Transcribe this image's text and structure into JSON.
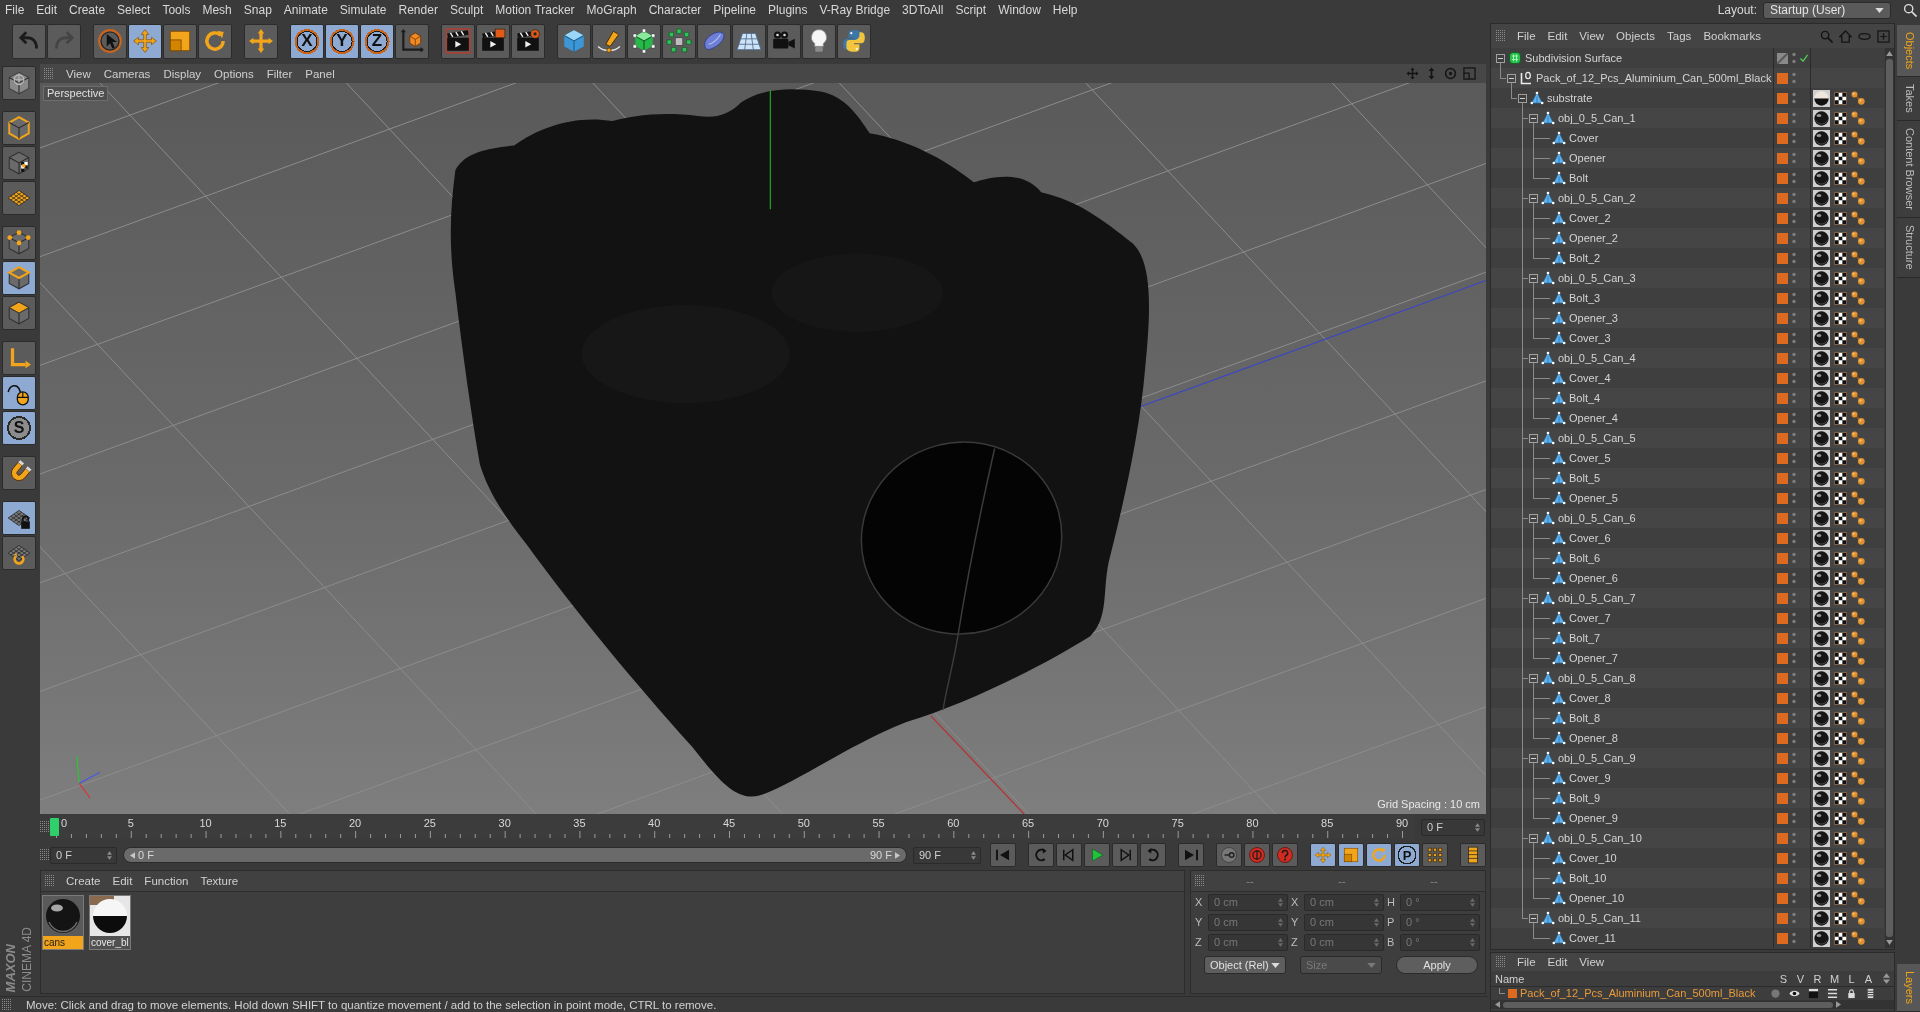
{
  "menubar": {
    "items": [
      "File",
      "Edit",
      "Create",
      "Select",
      "Tools",
      "Mesh",
      "Snap",
      "Animate",
      "Simulate",
      "Render",
      "Sculpt",
      "Motion Tracker",
      "MoGraph",
      "Character",
      "Pipeline",
      "Plugins",
      "V-Ray Bridge",
      "3DToAll",
      "Script",
      "Window",
      "Help"
    ],
    "layout_label": "Layout:",
    "layout_value": "Startup (User)"
  },
  "toolbar": {
    "groups": [
      [
        {
          "kind": "undo",
          "disabled": false
        },
        {
          "kind": "redo",
          "disabled": true
        }
      ],
      [
        {
          "kind": "liveselect",
          "selected": false
        },
        {
          "kind": "move",
          "selected": true
        },
        {
          "kind": "scale",
          "selected": false
        },
        {
          "kind": "rotate",
          "selected": false
        }
      ],
      [
        {
          "kind": "lasttool"
        }
      ],
      [
        {
          "kind": "axis",
          "label": "X",
          "selected": true
        },
        {
          "kind": "axis",
          "label": "Y",
          "selected": true
        },
        {
          "kind": "axis",
          "label": "Z",
          "selected": true
        },
        {
          "kind": "coordsystem"
        }
      ],
      [
        {
          "kind": "renderview"
        },
        {
          "kind": "renderpv"
        },
        {
          "kind": "rendersettings"
        }
      ],
      [
        {
          "kind": "cube"
        },
        {
          "kind": "pen"
        },
        {
          "kind": "subdivision"
        },
        {
          "kind": "cloner"
        },
        {
          "kind": "bend"
        },
        {
          "kind": "floor"
        },
        {
          "kind": "camera"
        },
        {
          "kind": "light"
        },
        {
          "kind": "python"
        }
      ]
    ]
  },
  "tool_palette": {
    "groups": [
      [
        {
          "kind": "makeeditable"
        }
      ],
      [
        {
          "kind": "model",
          "selected": false
        },
        {
          "kind": "texture",
          "selected": false
        },
        {
          "kind": "workplane",
          "selected": false
        }
      ],
      [
        {
          "kind": "points",
          "selected": false
        },
        {
          "kind": "edges",
          "selected": true
        },
        {
          "kind": "polygons",
          "selected": false
        }
      ],
      [
        {
          "kind": "axismode",
          "selected": false
        },
        {
          "kind": "tweak",
          "selected": true
        },
        {
          "kind": "solo",
          "label": "S",
          "selected": true
        }
      ],
      [
        {
          "kind": "magnet",
          "selected": false
        }
      ],
      [
        {
          "kind": "lockworkplane",
          "selected": true
        },
        {
          "kind": "planar",
          "selected": false
        }
      ]
    ],
    "brand": "MAXON",
    "product": "CINEMA 4D"
  },
  "viewport": {
    "menu": [
      "View",
      "Cameras",
      "Display",
      "Options",
      "Filter",
      "Panel"
    ],
    "camera": "Perspective",
    "grid_spacing": "Grid Spacing : 10 cm"
  },
  "timeline": {
    "ruler_labels": [
      "0",
      "5",
      "10",
      "15",
      "20",
      "25",
      "30",
      "35",
      "40",
      "45",
      "50",
      "55",
      "60",
      "65",
      "70",
      "75",
      "80",
      "85",
      "90"
    ],
    "level": 0,
    "current_frame": "0 F",
    "start_field": "0 F",
    "range": {
      "start": "0 F",
      "end": "90 F"
    },
    "end_field": "90 F",
    "controls": [
      [
        {
          "kind": "start"
        }
      ],
      [
        {
          "kind": "prevkey"
        },
        {
          "kind": "prevframe"
        },
        {
          "kind": "play"
        },
        {
          "kind": "nextframe"
        },
        {
          "kind": "nextkey"
        }
      ],
      [
        {
          "kind": "end"
        }
      ],
      [
        {
          "kind": "recordkeys"
        },
        {
          "kind": "autokey"
        },
        {
          "kind": "keyselection"
        }
      ],
      [
        {
          "kind": "poskey",
          "selected": true
        },
        {
          "kind": "scalekey",
          "selected": true
        },
        {
          "kind": "rotkey",
          "selected": true
        },
        {
          "kind": "paramkey",
          "label": "P",
          "selected": true
        },
        {
          "kind": "pla",
          "selected": false
        }
      ],
      [
        {
          "kind": "timelinewindow"
        }
      ]
    ]
  },
  "materials": {
    "menu": [
      "Create",
      "Edit",
      "Function",
      "Texture"
    ],
    "items": [
      {
        "name": "cans",
        "kind": "dark",
        "selected": true
      },
      {
        "name": "cover_bl",
        "kind": "split",
        "selected": false
      }
    ]
  },
  "coordinates": {
    "headers": [
      "--",
      "--",
      "--"
    ],
    "disabled": true,
    "rows": [
      {
        "position_axis": "X",
        "position": "0 cm",
        "size_axis": "X",
        "size": "0 cm",
        "rotation_axis": "H",
        "rotation": "0 °"
      },
      {
        "position_axis": "Y",
        "position": "0 cm",
        "size_axis": "Y",
        "size": "0 cm",
        "rotation_axis": "P",
        "rotation": "0 °"
      },
      {
        "position_axis": "Z",
        "position": "0 cm",
        "size_axis": "Z",
        "size": "0 cm",
        "rotation_axis": "B",
        "rotation": "0 °"
      }
    ],
    "mode": "Object (Rel)",
    "size_mode": "Size",
    "size_mode_disabled": true,
    "apply": "Apply"
  },
  "status_bar": {
    "text": "Move: Click and drag to move elements. Hold down SHIFT to quantize movement / add to the selection in point mode, CTRL to remove."
  },
  "objects": {
    "menu": [
      "File",
      "Edit",
      "View",
      "Objects",
      "Tags",
      "Bookmarks"
    ],
    "tree": [
      {
        "name": "Subdivision Surface",
        "kind": "subdivision",
        "expanded": true,
        "enabled": true,
        "children": [
          {
            "name": "Pack_of_12_Pcs_Aluminium_Can_500ml_Black",
            "kind": "null",
            "expanded": true,
            "color": "#dd6a1e",
            "children": [
              {
                "name": "substrate",
                "kind": "polygon",
                "expanded": true,
                "color": "#dd6a1e",
                "tags": [
                  {
                    "kind": "materialsplit"
                  },
                  {
                    "kind": "uvw"
                  },
                  {
                    "kind": "selection"
                  }
                ],
                "children": [
                  {
                    "name": "obj_0_5_Can_1",
                    "kind": "polygon",
                    "expanded": true,
                    "color": "#dd6a1e",
                    "tags": [
                      {
                        "kind": "material"
                      },
                      {
                        "kind": "uvw"
                      },
                      {
                        "kind": "selection"
                      }
                    ],
                    "children": [
                      {
                        "name": "Cover",
                        "kind": "polygon",
                        "color": "#dd6a1e",
                        "tags": [
                          {
                            "kind": "material"
                          },
                          {
                            "kind": "uvw"
                          },
                          {
                            "kind": "selection"
                          }
                        ]
                      },
                      {
                        "name": "Opener",
                        "kind": "polygon",
                        "color": "#dd6a1e",
                        "tags": [
                          {
                            "kind": "material"
                          },
                          {
                            "kind": "uvw"
                          },
                          {
                            "kind": "selection"
                          }
                        ]
                      },
                      {
                        "name": "Bolt",
                        "kind": "polygon",
                        "color": "#dd6a1e",
                        "tags": [
                          {
                            "kind": "material"
                          },
                          {
                            "kind": "uvw"
                          },
                          {
                            "kind": "selection"
                          }
                        ]
                      }
                    ]
                  },
                  {
                    "name": "obj_0_5_Can_2",
                    "kind": "polygon",
                    "expanded": true,
                    "color": "#dd6a1e",
                    "tags": [
                      {
                        "kind": "material"
                      },
                      {
                        "kind": "uvw"
                      },
                      {
                        "kind": "selection"
                      }
                    ],
                    "children": [
                      {
                        "name": "Cover_2",
                        "kind": "polygon",
                        "color": "#dd6a1e",
                        "tags": [
                          {
                            "kind": "material"
                          },
                          {
                            "kind": "uvw"
                          },
                          {
                            "kind": "selection"
                          }
                        ]
                      },
                      {
                        "name": "Opener_2",
                        "kind": "polygon",
                        "color": "#dd6a1e",
                        "tags": [
                          {
                            "kind": "material"
                          },
                          {
                            "kind": "uvw"
                          },
                          {
                            "kind": "selection"
                          }
                        ]
                      },
                      {
                        "name": "Bolt_2",
                        "kind": "polygon",
                        "color": "#dd6a1e",
                        "tags": [
                          {
                            "kind": "material"
                          },
                          {
                            "kind": "uvw"
                          },
                          {
                            "kind": "selection"
                          }
                        ]
                      }
                    ]
                  },
                  {
                    "name": "obj_0_5_Can_3",
                    "kind": "polygon",
                    "expanded": true,
                    "color": "#dd6a1e",
                    "tags": [
                      {
                        "kind": "material"
                      },
                      {
                        "kind": "uvw"
                      },
                      {
                        "kind": "selection"
                      }
                    ],
                    "children": [
                      {
                        "name": "Bolt_3",
                        "kind": "polygon",
                        "color": "#dd6a1e",
                        "tags": [
                          {
                            "kind": "material"
                          },
                          {
                            "kind": "uvw"
                          },
                          {
                            "kind": "selection"
                          }
                        ]
                      },
                      {
                        "name": "Opener_3",
                        "kind": "polygon",
                        "color": "#dd6a1e",
                        "tags": [
                          {
                            "kind": "material"
                          },
                          {
                            "kind": "uvw"
                          },
                          {
                            "kind": "selection"
                          }
                        ]
                      },
                      {
                        "name": "Cover_3",
                        "kind": "polygon",
                        "color": "#dd6a1e",
                        "tags": [
                          {
                            "kind": "material"
                          },
                          {
                            "kind": "uvw"
                          },
                          {
                            "kind": "selection"
                          }
                        ]
                      }
                    ]
                  },
                  {
                    "name": "obj_0_5_Can_4",
                    "kind": "polygon",
                    "expanded": true,
                    "color": "#dd6a1e",
                    "tags": [
                      {
                        "kind": "material"
                      },
                      {
                        "kind": "uvw"
                      },
                      {
                        "kind": "selection"
                      }
                    ],
                    "children": [
                      {
                        "name": "Cover_4",
                        "kind": "polygon",
                        "color": "#dd6a1e",
                        "tags": [
                          {
                            "kind": "material"
                          },
                          {
                            "kind": "uvw"
                          },
                          {
                            "kind": "selection"
                          }
                        ]
                      },
                      {
                        "name": "Bolt_4",
                        "kind": "polygon",
                        "color": "#dd6a1e",
                        "tags": [
                          {
                            "kind": "material"
                          },
                          {
                            "kind": "uvw"
                          },
                          {
                            "kind": "selection"
                          }
                        ]
                      },
                      {
                        "name": "Opener_4",
                        "kind": "polygon",
                        "color": "#dd6a1e",
                        "tags": [
                          {
                            "kind": "material"
                          },
                          {
                            "kind": "uvw"
                          },
                          {
                            "kind": "selection"
                          }
                        ]
                      }
                    ]
                  },
                  {
                    "name": "obj_0_5_Can_5",
                    "kind": "polygon",
                    "expanded": true,
                    "color": "#dd6a1e",
                    "tags": [
                      {
                        "kind": "material"
                      },
                      {
                        "kind": "uvw"
                      },
                      {
                        "kind": "selection"
                      }
                    ],
                    "children": [
                      {
                        "name": "Cover_5",
                        "kind": "polygon",
                        "color": "#dd6a1e",
                        "tags": [
                          {
                            "kind": "material"
                          },
                          {
                            "kind": "uvw"
                          },
                          {
                            "kind": "selection"
                          }
                        ]
                      },
                      {
                        "name": "Bolt_5",
                        "kind": "polygon",
                        "color": "#dd6a1e",
                        "tags": [
                          {
                            "kind": "material"
                          },
                          {
                            "kind": "uvw"
                          },
                          {
                            "kind": "selection"
                          }
                        ]
                      },
                      {
                        "name": "Opener_5",
                        "kind": "polygon",
                        "color": "#dd6a1e",
                        "tags": [
                          {
                            "kind": "material"
                          },
                          {
                            "kind": "uvw"
                          },
                          {
                            "kind": "selection"
                          }
                        ]
                      }
                    ]
                  },
                  {
                    "name": "obj_0_5_Can_6",
                    "kind": "polygon",
                    "expanded": true,
                    "color": "#dd6a1e",
                    "tags": [
                      {
                        "kind": "material"
                      },
                      {
                        "kind": "uvw"
                      },
                      {
                        "kind": "selection"
                      }
                    ],
                    "children": [
                      {
                        "name": "Cover_6",
                        "kind": "polygon",
                        "color": "#dd6a1e",
                        "tags": [
                          {
                            "kind": "material"
                          },
                          {
                            "kind": "uvw"
                          },
                          {
                            "kind": "selection"
                          }
                        ]
                      },
                      {
                        "name": "Bolt_6",
                        "kind": "polygon",
                        "color": "#dd6a1e",
                        "tags": [
                          {
                            "kind": "material"
                          },
                          {
                            "kind": "uvw"
                          },
                          {
                            "kind": "selection"
                          }
                        ]
                      },
                      {
                        "name": "Opener_6",
                        "kind": "polygon",
                        "color": "#dd6a1e",
                        "tags": [
                          {
                            "kind": "material"
                          },
                          {
                            "kind": "uvw"
                          },
                          {
                            "kind": "selection"
                          }
                        ]
                      }
                    ]
                  },
                  {
                    "name": "obj_0_5_Can_7",
                    "kind": "polygon",
                    "expanded": true,
                    "color": "#dd6a1e",
                    "tags": [
                      {
                        "kind": "material"
                      },
                      {
                        "kind": "uvw"
                      },
                      {
                        "kind": "selection"
                      }
                    ],
                    "children": [
                      {
                        "name": "Cover_7",
                        "kind": "polygon",
                        "color": "#dd6a1e",
                        "tags": [
                          {
                            "kind": "material"
                          },
                          {
                            "kind": "uvw"
                          },
                          {
                            "kind": "selection"
                          }
                        ]
                      },
                      {
                        "name": "Bolt_7",
                        "kind": "polygon",
                        "color": "#dd6a1e",
                        "tags": [
                          {
                            "kind": "material"
                          },
                          {
                            "kind": "uvw"
                          },
                          {
                            "kind": "selection"
                          }
                        ]
                      },
                      {
                        "name": "Opener_7",
                        "kind": "polygon",
                        "color": "#dd6a1e",
                        "tags": [
                          {
                            "kind": "material"
                          },
                          {
                            "kind": "uvw"
                          },
                          {
                            "kind": "selection"
                          }
                        ]
                      }
                    ]
                  },
                  {
                    "name": "obj_0_5_Can_8",
                    "kind": "polygon",
                    "expanded": true,
                    "color": "#dd6a1e",
                    "tags": [
                      {
                        "kind": "material"
                      },
                      {
                        "kind": "uvw"
                      },
                      {
                        "kind": "selection"
                      }
                    ],
                    "children": [
                      {
                        "name": "Cover_8",
                        "kind": "polygon",
                        "color": "#dd6a1e",
                        "tags": [
                          {
                            "kind": "material"
                          },
                          {
                            "kind": "uvw"
                          },
                          {
                            "kind": "selection"
                          }
                        ]
                      },
                      {
                        "name": "Bolt_8",
                        "kind": "polygon",
                        "color": "#dd6a1e",
                        "tags": [
                          {
                            "kind": "material"
                          },
                          {
                            "kind": "uvw"
                          },
                          {
                            "kind": "selection"
                          }
                        ]
                      },
                      {
                        "name": "Opener_8",
                        "kind": "polygon",
                        "color": "#dd6a1e",
                        "tags": [
                          {
                            "kind": "material"
                          },
                          {
                            "kind": "uvw"
                          },
                          {
                            "kind": "selection"
                          }
                        ]
                      }
                    ]
                  },
                  {
                    "name": "obj_0_5_Can_9",
                    "kind": "polygon",
                    "expanded": true,
                    "color": "#dd6a1e",
                    "tags": [
                      {
                        "kind": "material"
                      },
                      {
                        "kind": "uvw"
                      },
                      {
                        "kind": "selection"
                      }
                    ],
                    "children": [
                      {
                        "name": "Cover_9",
                        "kind": "polygon",
                        "color": "#dd6a1e",
                        "tags": [
                          {
                            "kind": "material"
                          },
                          {
                            "kind": "uvw"
                          },
                          {
                            "kind": "selection"
                          }
                        ]
                      },
                      {
                        "name": "Bolt_9",
                        "kind": "polygon",
                        "color": "#dd6a1e",
                        "tags": [
                          {
                            "kind": "material"
                          },
                          {
                            "kind": "uvw"
                          },
                          {
                            "kind": "selection"
                          }
                        ]
                      },
                      {
                        "name": "Opener_9",
                        "kind": "polygon",
                        "color": "#dd6a1e",
                        "tags": [
                          {
                            "kind": "material"
                          },
                          {
                            "kind": "uvw"
                          },
                          {
                            "kind": "selection"
                          }
                        ]
                      }
                    ]
                  },
                  {
                    "name": "obj_0_5_Can_10",
                    "kind": "polygon",
                    "expanded": true,
                    "color": "#dd6a1e",
                    "tags": [
                      {
                        "kind": "material"
                      },
                      {
                        "kind": "uvw"
                      },
                      {
                        "kind": "selection"
                      }
                    ],
                    "children": [
                      {
                        "name": "Cover_10",
                        "kind": "polygon",
                        "color": "#dd6a1e",
                        "tags": [
                          {
                            "kind": "material"
                          },
                          {
                            "kind": "uvw"
                          },
                          {
                            "kind": "selection"
                          }
                        ]
                      },
                      {
                        "name": "Bolt_10",
                        "kind": "polygon",
                        "color": "#dd6a1e",
                        "tags": [
                          {
                            "kind": "material"
                          },
                          {
                            "kind": "uvw"
                          },
                          {
                            "kind": "selection"
                          }
                        ]
                      },
                      {
                        "name": "Opener_10",
                        "kind": "polygon",
                        "color": "#dd6a1e",
                        "tags": [
                          {
                            "kind": "material"
                          },
                          {
                            "kind": "uvw"
                          },
                          {
                            "kind": "selection"
                          }
                        ]
                      }
                    ]
                  },
                  {
                    "name": "obj_0_5_Can_11",
                    "kind": "polygon",
                    "expanded": true,
                    "color": "#dd6a1e",
                    "tags": [
                      {
                        "kind": "material"
                      },
                      {
                        "kind": "uvw"
                      },
                      {
                        "kind": "selection"
                      }
                    ],
                    "children": [
                      {
                        "name": "Cover_11",
                        "kind": "polygon",
                        "color": "#dd6a1e",
                        "tags": [
                          {
                            "kind": "material"
                          },
                          {
                            "kind": "uvw"
                          },
                          {
                            "kind": "selection"
                          }
                        ]
                      }
                    ]
                  }
                ]
              }
            ]
          }
        ]
      }
    ]
  },
  "layers": {
    "menu": [
      "File",
      "Edit",
      "View"
    ],
    "columns": [
      "Name",
      "S",
      "V",
      "R",
      "M",
      "L",
      "A"
    ],
    "rows": [
      {
        "name": "Pack_of_12_Pcs_Aluminium_Can_500ml_Black",
        "color": "#dd6a1e"
      }
    ]
  },
  "side_tabs": {
    "top": [
      {
        "label": "Objects",
        "selected": true
      },
      {
        "label": "Takes",
        "selected": false
      },
      {
        "label": "Content Browser",
        "selected": false
      },
      {
        "label": "Structure",
        "selected": false
      }
    ],
    "bottom": [
      {
        "label": "Layers",
        "selected": true
      }
    ]
  }
}
